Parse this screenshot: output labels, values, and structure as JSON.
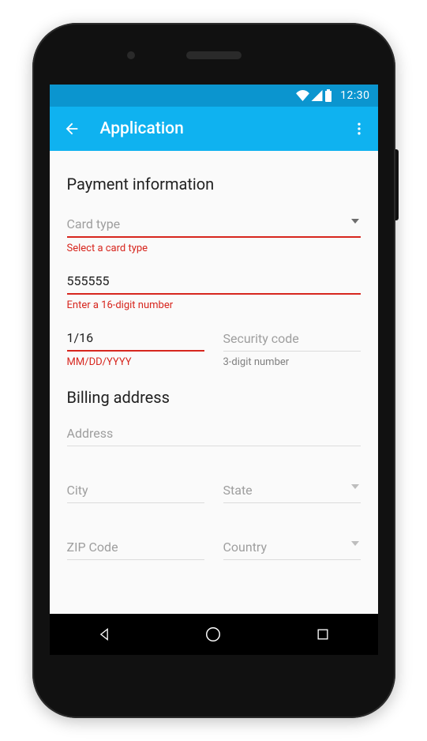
{
  "status": {
    "time": "12:30"
  },
  "appbar": {
    "title": "Application"
  },
  "sections": {
    "payment": "Payment information",
    "billing": "Billing address"
  },
  "fields": {
    "card_type": {
      "placeholder": "Card type",
      "error": "Select a card type"
    },
    "card_number": {
      "value": "555555",
      "error": "Enter a 16-digit number"
    },
    "exp": {
      "value": "1/16",
      "helper": "MM/DD/YYYY"
    },
    "cvv": {
      "placeholder": "Security code",
      "helper": "3-digit number"
    },
    "address": {
      "placeholder": "Address"
    },
    "city": {
      "placeholder": "City"
    },
    "state": {
      "placeholder": "State"
    },
    "zip": {
      "placeholder": "ZIP Code"
    },
    "country": {
      "placeholder": "Country"
    }
  }
}
